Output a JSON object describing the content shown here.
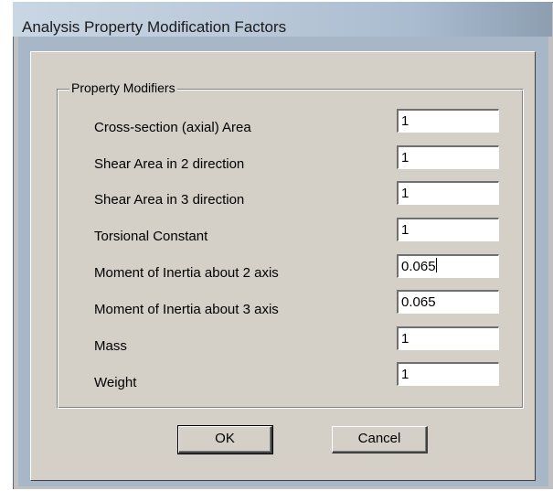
{
  "window": {
    "title": "Analysis Property Modification Factors"
  },
  "group": {
    "title": "Property Modifiers"
  },
  "rows": [
    {
      "label": "Cross-section (axial) Area",
      "value": "1"
    },
    {
      "label": "Shear Area in 2 direction",
      "value": "1"
    },
    {
      "label": "Shear Area in 3 direction",
      "value": "1"
    },
    {
      "label": "Torsional Constant",
      "value": "1"
    },
    {
      "label": "Moment of Inertia about 2 axis",
      "value": "0.065"
    },
    {
      "label": "Moment of Inertia about 3 axis",
      "value": "0.065"
    },
    {
      "label": "Mass",
      "value": "1"
    },
    {
      "label": "Weight",
      "value": "1"
    }
  ],
  "buttons": {
    "ok_label": "OK",
    "cancel_label": "Cancel"
  },
  "colors": {
    "dialog_face": "#d4d0c8",
    "titlebar": "#b9c8d8"
  }
}
